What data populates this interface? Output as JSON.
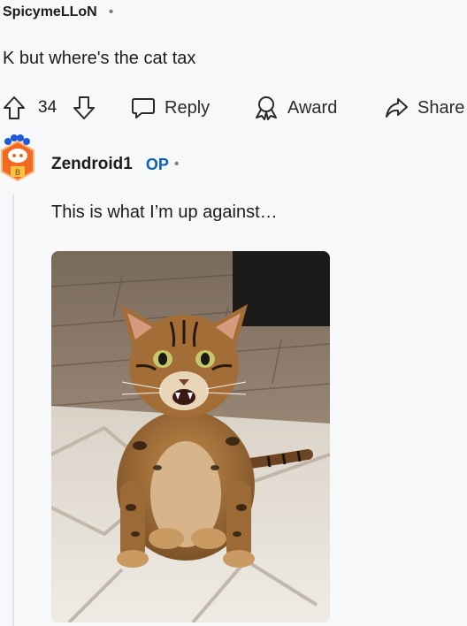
{
  "comment": {
    "author": "SpicymeLLoN",
    "separator": "•",
    "text": "K but where's the cat tax",
    "actions": {
      "vote_count": "34",
      "reply_label": "Reply",
      "award_label": "Award",
      "share_label": "Share"
    }
  },
  "reply": {
    "author": "Zendroid1",
    "op_badge": "OP",
    "separator": "•",
    "text": "This is what I’m up against…"
  },
  "icons": {
    "upvote": "arrow-up-icon",
    "downvote": "arrow-down-icon",
    "reply": "speech-bubble-icon",
    "award": "ribbon-award-icon",
    "share": "share-arrow-icon"
  },
  "colors": {
    "background": "#f7f8fa",
    "op_badge": "#0f5fb9",
    "text": "#1c1c1c"
  }
}
